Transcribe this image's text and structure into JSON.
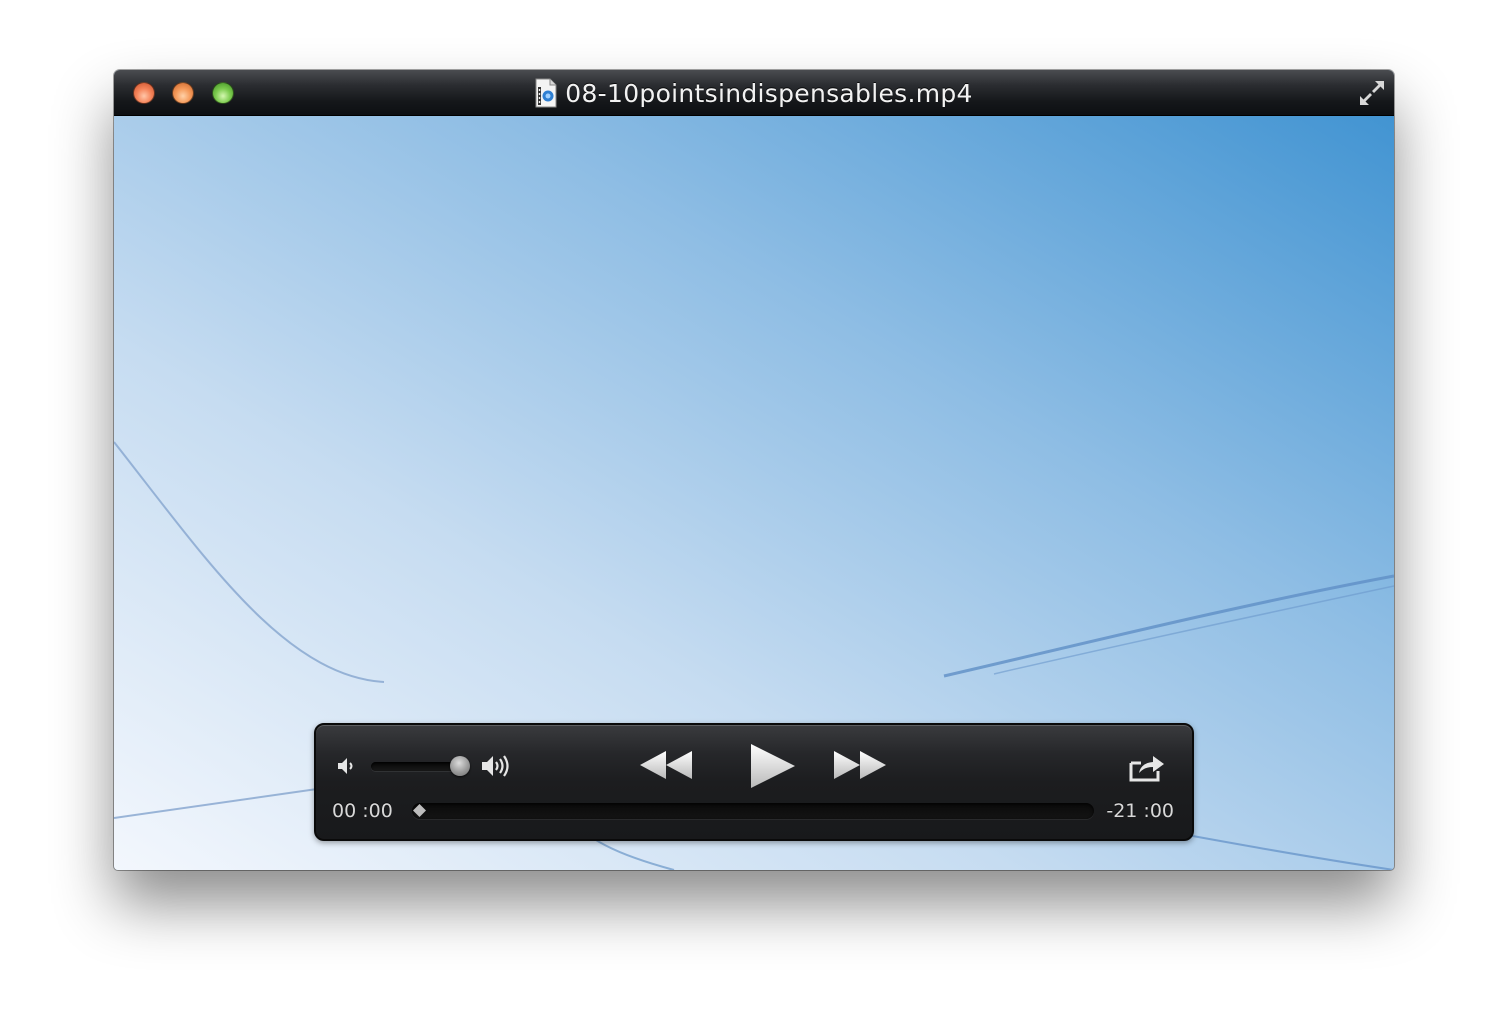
{
  "window": {
    "title": "08-10pointsindispensables.mp4",
    "controls": {
      "close": "close-icon",
      "minimize": "minimize-icon",
      "zoom": "zoom-icon",
      "fullscreen": "fullscreen-arrows-icon"
    },
    "document_icon": "movie-file-icon"
  },
  "player": {
    "elapsed": "00 :00",
    "remaining": "-21 :00",
    "playback_progress": 0,
    "volume_level": 0.95,
    "buttons": {
      "volume_low": "speaker-low-icon",
      "volume_high": "speaker-high-icon",
      "rewind": "rewind-icon",
      "play": "play-icon",
      "fast_forward": "fast-forward-icon",
      "share": "share-icon"
    }
  },
  "colors": {
    "titlebar": "#15171a",
    "controller": "#1c1d1f",
    "video_light": "#f3f7fd",
    "video_dark": "#4294d2",
    "control_glyph": "#e6e6e6"
  }
}
